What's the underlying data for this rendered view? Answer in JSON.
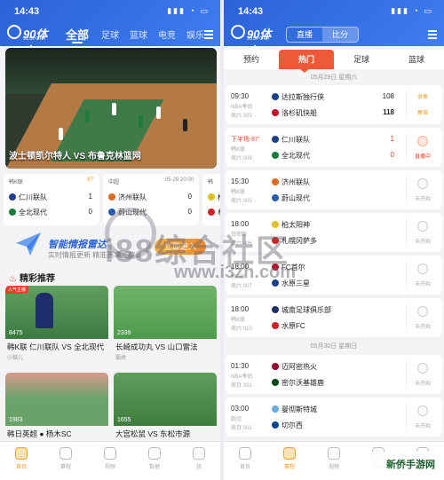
{
  "left": {
    "status_time": "14:43",
    "logo": {
      "main": "90体育",
      "sub": "90SPORT"
    },
    "tabs": [
      "全部",
      "足球",
      "篮球",
      "电竞",
      "娱乐"
    ],
    "video_caption": "波士顿凯尔特人 VS 布鲁克林篮网",
    "cards": [
      {
        "league": "韩K联",
        "status": "87'",
        "home": "仁川联队",
        "away": "全北现代",
        "home_score": "1",
        "away_score": "0"
      },
      {
        "league": "中超",
        "status": "05-28 20:00",
        "home": "济州联队",
        "away": "蔚山现代",
        "home_score": "0",
        "away_score": "0"
      },
      {
        "league": "韩",
        "status": "",
        "home": "柏太",
        "away": "札幌",
        "home_score": "",
        "away_score": ""
      }
    ],
    "promo": {
      "title": "智能情报雷达",
      "subtitle": "实时情报更新  精准赛事推荐",
      "button": "立即进入"
    },
    "section_title": "精彩推荐",
    "videos": [
      {
        "views": "8475",
        "title": "韩K联 仁川联队 VS 全北现代",
        "sub": "小猫儿",
        "tag": "人气主播"
      },
      {
        "views": "2339",
        "title": "长崎成功丸 VS 山口雷法",
        "sub": "霸虎"
      },
      {
        "views": "1983",
        "title": "韩日英超 ● 杨木SC",
        "sub": ""
      },
      {
        "views": "1655",
        "title": "大宫松鼠 VS 东松市源",
        "sub": ""
      }
    ],
    "bottom_nav": [
      "首页",
      "赛程",
      "视频",
      "数据",
      "我"
    ]
  },
  "right": {
    "status_time": "14:43",
    "segment": [
      "直播",
      "比分"
    ],
    "tabs": [
      "预约",
      "热门",
      "足球",
      "篮球"
    ],
    "day1": "05月29日 星期六",
    "day2": "05月30日 星期日",
    "rows": [
      {
        "time": "09:30",
        "league": "NBA季后",
        "stage": "周六 305",
        "home": "达拉斯独行侠",
        "away": "洛杉矶快船",
        "home_score": "108",
        "away_score": "118",
        "action": "录像",
        "action2": "集锦"
      },
      {
        "time": "下半场 87'",
        "league": "韩K联",
        "stage": "周六 009",
        "home": "仁川联队",
        "away": "全北现代",
        "home_score": "1",
        "away_score": "0",
        "action": "直播中"
      },
      {
        "time": "15:30",
        "league": "韩K联",
        "stage": "周六 005",
        "home": "济州联队",
        "away": "蔚山现代",
        "action": "未开始"
      },
      {
        "time": "18:00",
        "league": "日职联",
        "stage": "周六 006",
        "home": "柏太阳神",
        "away": "札幌冈萨多",
        "action": "未开始"
      },
      {
        "time": "18:00",
        "league": "韩K联",
        "stage": "周六 007",
        "home": "FC首尔",
        "away": "水原三星",
        "action": "未开始"
      },
      {
        "time": "18:00",
        "league": "韩K联",
        "stage": "周六 010",
        "home": "城南足球俱乐部",
        "away": "水原FC",
        "action": "未开始"
      },
      {
        "time": "01:30",
        "league": "NBA季后",
        "stage": "周日 301",
        "home": "迈阿密热火",
        "away": "密尔沃基雄鹿",
        "action": "未开始"
      },
      {
        "time": "03:00",
        "league": "欧冠",
        "stage": "周日 001",
        "home": "曼彻斯特城",
        "away": "切尔西",
        "action": "未开始"
      }
    ],
    "bottom_nav": [
      "首页",
      "赛程",
      "视频",
      "数据",
      "我"
    ]
  },
  "watermark": {
    "text": "i88综合社区",
    "url": "www.i3zh.com",
    "corner": "新侨手游网"
  }
}
